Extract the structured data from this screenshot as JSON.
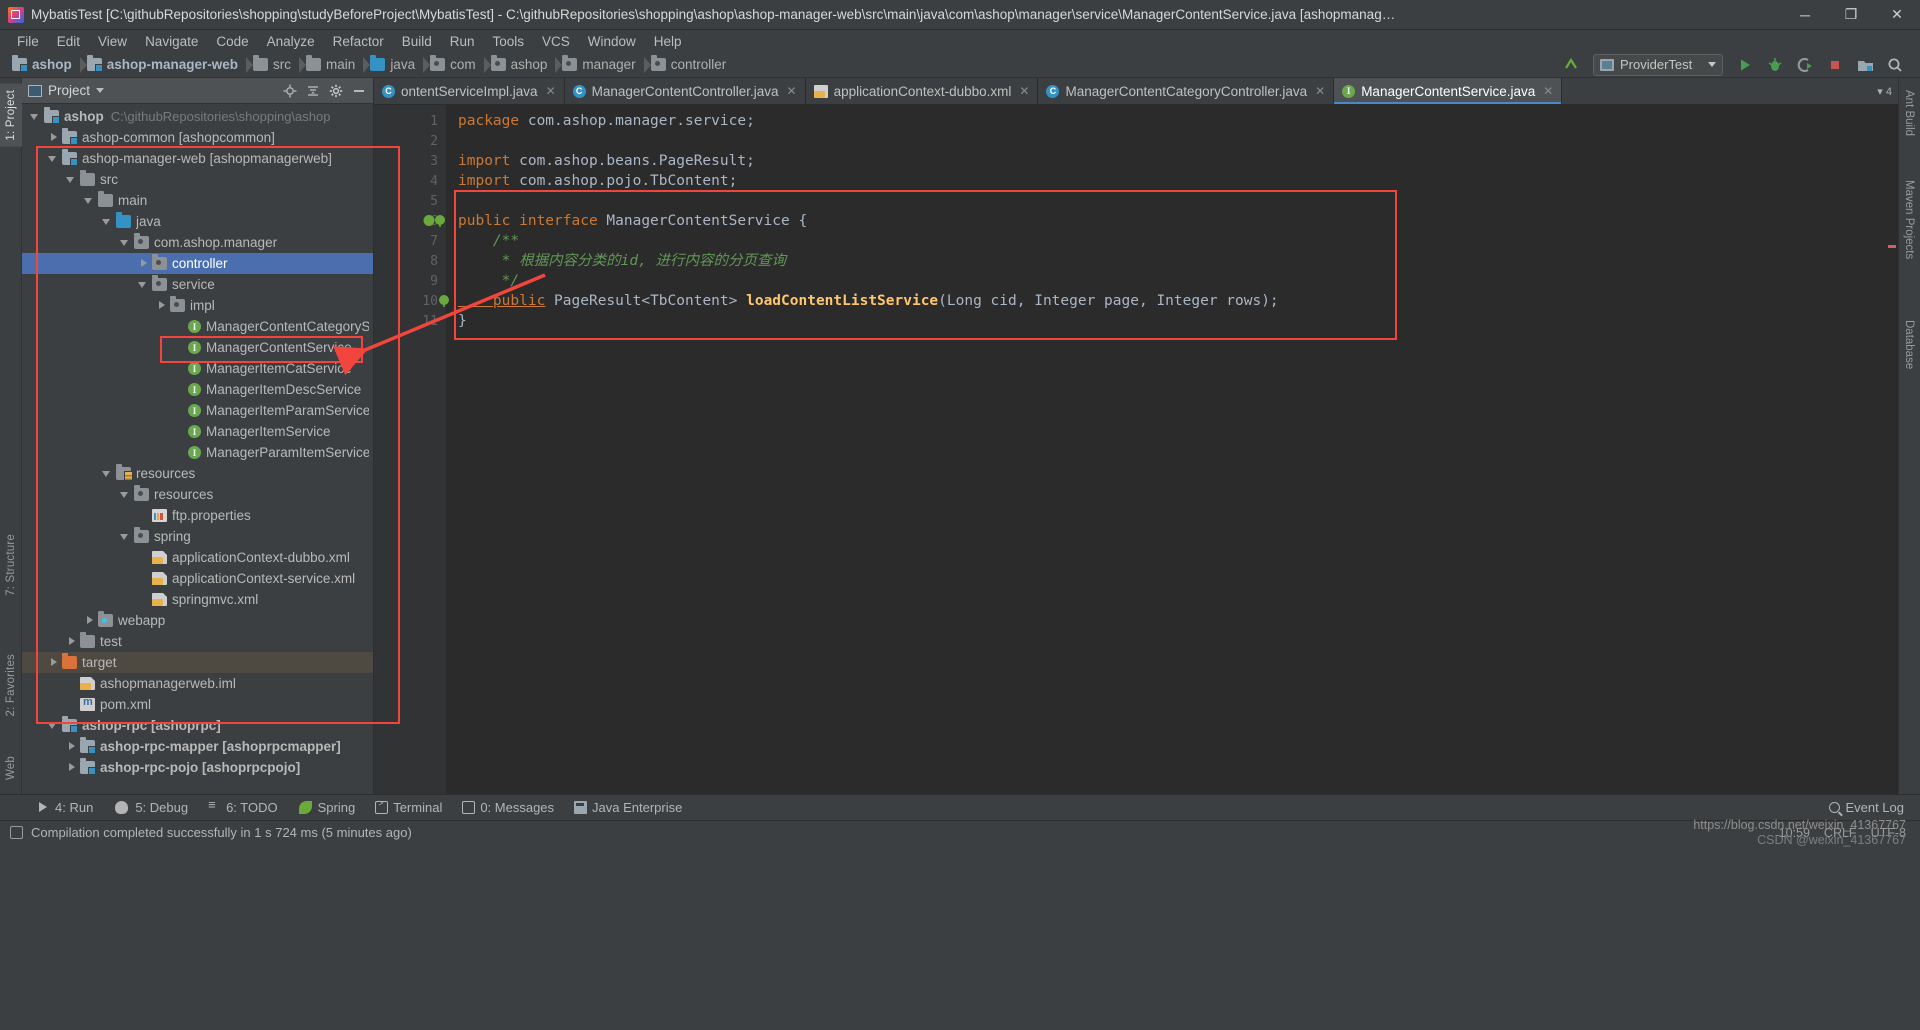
{
  "window": {
    "title": "MybatisTest [C:\\githubRepositories\\shopping\\studyBeforeProject\\MybatisTest] - C:\\githubRepositories\\shopping\\ashop\\ashop-manager-web\\src\\main\\java\\com\\ashop\\manager\\service\\ManagerContentService.java [ashopmanagerw...",
    "minimize": "─",
    "maximize": "❐",
    "close": "✕"
  },
  "menubar": [
    {
      "label": "File"
    },
    {
      "label": "Edit"
    },
    {
      "label": "View"
    },
    {
      "label": "Navigate"
    },
    {
      "label": "Code"
    },
    {
      "label": "Analyze"
    },
    {
      "label": "Refactor"
    },
    {
      "label": "Build"
    },
    {
      "label": "Run"
    },
    {
      "label": "Tools"
    },
    {
      "label": "VCS"
    },
    {
      "label": "Window"
    },
    {
      "label": "Help"
    }
  ],
  "navbar": {
    "crumbs": [
      {
        "label": "ashop",
        "icon": "module-folder-icon",
        "bold": true
      },
      {
        "label": "ashop-manager-web",
        "icon": "module-folder-icon",
        "bold": true
      },
      {
        "label": "src",
        "icon": "folder-icon",
        "bold": false
      },
      {
        "label": "main",
        "icon": "folder-icon",
        "bold": false
      },
      {
        "label": "java",
        "icon": "source-folder-icon",
        "bold": false
      },
      {
        "label": "com",
        "icon": "package-icon",
        "bold": false
      },
      {
        "label": "ashop",
        "icon": "package-icon",
        "bold": false
      },
      {
        "label": "manager",
        "icon": "package-icon",
        "bold": false
      },
      {
        "label": "controller",
        "icon": "package-icon",
        "bold": false
      }
    ],
    "run_config": "ProviderTest",
    "icons": [
      "search-everywhere-icon",
      "run-icon",
      "debug-icon",
      "run-coverage-icon",
      "stop-icon",
      "project-structure-icon",
      "search-icon"
    ]
  },
  "left_strips": [
    {
      "label": "1: Project",
      "active": true
    },
    {
      "label": "7: Structure",
      "active": false
    },
    {
      "label": "2: Favorites",
      "active": false
    },
    {
      "label": "Web",
      "active": false
    }
  ],
  "right_strips": [
    {
      "label": "Ant Build"
    },
    {
      "label": "Maven Projects"
    },
    {
      "label": "Database"
    }
  ],
  "project_panel": {
    "title": "Project",
    "icons": [
      "locate-icon",
      "collapse-all-icon",
      "gear-icon",
      "hide-icon"
    ],
    "tree": [
      {
        "indent": 0,
        "arrow": "down",
        "icon": "module-folder-icon",
        "label": "ashop",
        "bold": true,
        "path": "C:\\githubRepositories\\shopping\\ashop",
        "state": "normal"
      },
      {
        "indent": 1,
        "arrow": "right",
        "icon": "module-folder-icon",
        "label": "ashop-common [ashopcommon]",
        "bold": false,
        "path": "",
        "state": "normal"
      },
      {
        "indent": 1,
        "arrow": "down",
        "icon": "module-folder-icon",
        "label": "ashop-manager-web [ashopmanagerweb]",
        "bold": false,
        "path": "",
        "state": "normal"
      },
      {
        "indent": 2,
        "arrow": "down",
        "icon": "folder-icon",
        "label": "src",
        "bold": false,
        "path": "",
        "state": "normal"
      },
      {
        "indent": 3,
        "arrow": "down",
        "icon": "folder-icon",
        "label": "main",
        "bold": false,
        "path": "",
        "state": "normal"
      },
      {
        "indent": 4,
        "arrow": "down",
        "icon": "source-folder-icon",
        "label": "java",
        "bold": false,
        "path": "",
        "state": "normal"
      },
      {
        "indent": 5,
        "arrow": "down",
        "icon": "package-icon",
        "label": "com.ashop.manager",
        "bold": false,
        "path": "",
        "state": "normal"
      },
      {
        "indent": 6,
        "arrow": "right",
        "icon": "package-icon",
        "label": "controller",
        "bold": false,
        "path": "",
        "state": "selected"
      },
      {
        "indent": 6,
        "arrow": "down",
        "icon": "package-icon",
        "label": "service",
        "bold": false,
        "path": "",
        "state": "normal"
      },
      {
        "indent": 7,
        "arrow": "right",
        "icon": "package-icon",
        "label": "impl",
        "bold": false,
        "path": "",
        "state": "normal"
      },
      {
        "indent": 8,
        "arrow": "none",
        "icon": "interface-icon",
        "label": "ManagerContentCategoryService",
        "bold": false,
        "path": "",
        "state": "normal"
      },
      {
        "indent": 8,
        "arrow": "none",
        "icon": "interface-icon",
        "label": "ManagerContentService",
        "bold": false,
        "path": "",
        "state": "normal"
      },
      {
        "indent": 8,
        "arrow": "none",
        "icon": "interface-icon",
        "label": "ManagerItemCatService",
        "bold": false,
        "path": "",
        "state": "normal"
      },
      {
        "indent": 8,
        "arrow": "none",
        "icon": "interface-icon",
        "label": "ManagerItemDescService",
        "bold": false,
        "path": "",
        "state": "normal"
      },
      {
        "indent": 8,
        "arrow": "none",
        "icon": "interface-icon",
        "label": "ManagerItemParamService",
        "bold": false,
        "path": "",
        "state": "normal"
      },
      {
        "indent": 8,
        "arrow": "none",
        "icon": "interface-icon",
        "label": "ManagerItemService",
        "bold": false,
        "path": "",
        "state": "normal"
      },
      {
        "indent": 8,
        "arrow": "none",
        "icon": "interface-icon",
        "label": "ManagerParamItemService",
        "bold": false,
        "path": "",
        "state": "normal"
      },
      {
        "indent": 4,
        "arrow": "down",
        "icon": "resource-folder-icon",
        "label": "resources",
        "bold": false,
        "path": "",
        "state": "normal"
      },
      {
        "indent": 5,
        "arrow": "down",
        "icon": "package-icon",
        "label": "resources",
        "bold": false,
        "path": "",
        "state": "normal"
      },
      {
        "indent": 6,
        "arrow": "none",
        "icon": "properties-file-icon",
        "label": "ftp.properties",
        "bold": false,
        "path": "",
        "state": "normal"
      },
      {
        "indent": 5,
        "arrow": "down",
        "icon": "package-icon",
        "label": "spring",
        "bold": false,
        "path": "",
        "state": "normal"
      },
      {
        "indent": 6,
        "arrow": "none",
        "icon": "spring-xml-icon",
        "label": "applicationContext-dubbo.xml",
        "bold": false,
        "path": "",
        "state": "normal"
      },
      {
        "indent": 6,
        "arrow": "none",
        "icon": "spring-xml-icon",
        "label": "applicationContext-service.xml",
        "bold": false,
        "path": "",
        "state": "normal"
      },
      {
        "indent": 6,
        "arrow": "none",
        "icon": "spring-xml-icon",
        "label": "springmvc.xml",
        "bold": false,
        "path": "",
        "state": "normal"
      },
      {
        "indent": 3,
        "arrow": "right",
        "icon": "webapp-folder-icon",
        "label": "webapp",
        "bold": false,
        "path": "",
        "state": "normal"
      },
      {
        "indent": 2,
        "arrow": "right",
        "icon": "test-folder-icon",
        "label": "test",
        "bold": false,
        "path": "",
        "state": "normal"
      },
      {
        "indent": 1,
        "arrow": "right",
        "icon": "target-folder-icon",
        "label": "target",
        "bold": false,
        "path": "",
        "state": "highlighted"
      },
      {
        "indent": 2,
        "arrow": "none",
        "icon": "iml-file-icon",
        "label": "ashopmanagerweb.iml",
        "bold": false,
        "path": "",
        "state": "normal"
      },
      {
        "indent": 2,
        "arrow": "none",
        "icon": "maven-pom-icon",
        "label": "pom.xml",
        "bold": false,
        "path": "",
        "state": "normal"
      },
      {
        "indent": 1,
        "arrow": "down",
        "icon": "module-folder-icon",
        "label": "ashop-rpc [ashoprpc]",
        "bold": true,
        "path": "",
        "state": "normal"
      },
      {
        "indent": 2,
        "arrow": "right",
        "icon": "module-folder-icon",
        "label": "ashop-rpc-mapper [ashoprpcmapper]",
        "bold": true,
        "path": "",
        "state": "normal"
      },
      {
        "indent": 2,
        "arrow": "right",
        "icon": "module-folder-icon",
        "label": "ashop-rpc-pojo [ashoprpcpojo]",
        "bold": true,
        "path": "",
        "state": "normal"
      }
    ]
  },
  "editor": {
    "tabs": [
      {
        "label": "ontentServiceImpl.java",
        "icon": "java-class-icon",
        "active": false,
        "truncated": true
      },
      {
        "label": "ManagerContentController.java",
        "icon": "java-class-icon",
        "active": false,
        "truncated": false
      },
      {
        "label": "applicationContext-dubbo.xml",
        "icon": "spring-xml-icon",
        "active": false,
        "truncated": false
      },
      {
        "label": "ManagerContentCategoryController.java",
        "icon": "java-class-icon",
        "active": false,
        "truncated": false
      },
      {
        "label": "ManagerContentService.java",
        "icon": "java-interface-icon",
        "active": true,
        "truncated": false
      }
    ],
    "tab_overflow": "▾ 4",
    "close_glyph": "✕",
    "line_numbers": [
      "1",
      "2",
      "3",
      "4",
      "5",
      "6",
      "7",
      "8",
      "9",
      "10",
      "11"
    ],
    "code_lines": [
      {
        "n": 1,
        "tokens": [
          {
            "t": "package ",
            "c": "kw"
          },
          {
            "t": "com.ashop.manager.service;",
            "c": "pln"
          }
        ]
      },
      {
        "n": 2,
        "tokens": []
      },
      {
        "n": 3,
        "tokens": [
          {
            "t": "import ",
            "c": "kw"
          },
          {
            "t": "com.ashop.beans.PageResult;",
            "c": "pln"
          }
        ]
      },
      {
        "n": 4,
        "tokens": [
          {
            "t": "import ",
            "c": "kw"
          },
          {
            "t": "com.ashop.pojo.TbContent;",
            "c": "pln"
          }
        ]
      },
      {
        "n": 5,
        "tokens": []
      },
      {
        "n": 6,
        "tokens": [
          {
            "t": "public interface ",
            "c": "kw"
          },
          {
            "t": "ManagerContentService {",
            "c": "pln"
          }
        ]
      },
      {
        "n": 7,
        "tokens": [
          {
            "t": "    /**",
            "c": "cm"
          }
        ]
      },
      {
        "n": 8,
        "tokens": [
          {
            "t": "     * 根据内容分类的id, 进行内容的分页查询",
            "c": "cm"
          }
        ]
      },
      {
        "n": 9,
        "tokens": [
          {
            "t": "     */",
            "c": "cm"
          }
        ]
      },
      {
        "n": 10,
        "tokens": [
          {
            "t": "    public",
            "c": "kwu"
          },
          {
            "t": " PageResult<TbContent> ",
            "c": "pln"
          },
          {
            "t": "loadContentListService",
            "c": "mth"
          },
          {
            "t": "(",
            "c": "pln"
          },
          {
            "t": "Long",
            "c": "typ"
          },
          {
            "t": " cid, ",
            "c": "pln"
          },
          {
            "t": "Integer",
            "c": "typ"
          },
          {
            "t": " page, ",
            "c": "pln"
          },
          {
            "t": "Integer",
            "c": "typ"
          },
          {
            "t": " rows);",
            "c": "pln"
          }
        ]
      },
      {
        "n": 11,
        "tokens": [
          {
            "t": "}",
            "c": "pln"
          }
        ]
      }
    ]
  },
  "bottom_bar": {
    "items": [
      {
        "label": "4: Run",
        "icon": "run-icon"
      },
      {
        "label": "5: Debug",
        "icon": "debug-icon"
      },
      {
        "label": "6: TODO",
        "icon": "todo-icon"
      },
      {
        "label": "Spring",
        "icon": "spring-icon"
      },
      {
        "label": "Terminal",
        "icon": "terminal-icon"
      },
      {
        "label": "0: Messages",
        "icon": "messages-icon"
      },
      {
        "label": "Java Enterprise",
        "icon": "java-enterprise-icon"
      }
    ],
    "event_log": "Event Log"
  },
  "status_bar": {
    "message": "Compilation completed successfully in 1 s 724 ms (5 minutes ago)",
    "caret": "10:59",
    "line_sep": "CRLF",
    "encoding": "UTF-8"
  },
  "watermark": {
    "line1": "https://blog.csdn.net/weixin_41367767",
    "line2": "CSDN @weixin_41367767"
  },
  "annotations": {
    "accent_red": "#f2453d",
    "boxes": [
      {
        "name": "project-tree-highlight-box"
      },
      {
        "name": "manager-content-service-highlight-box"
      },
      {
        "name": "code-interface-highlight-box"
      }
    ],
    "arrow": {
      "name": "red-pointer-arrow"
    }
  }
}
